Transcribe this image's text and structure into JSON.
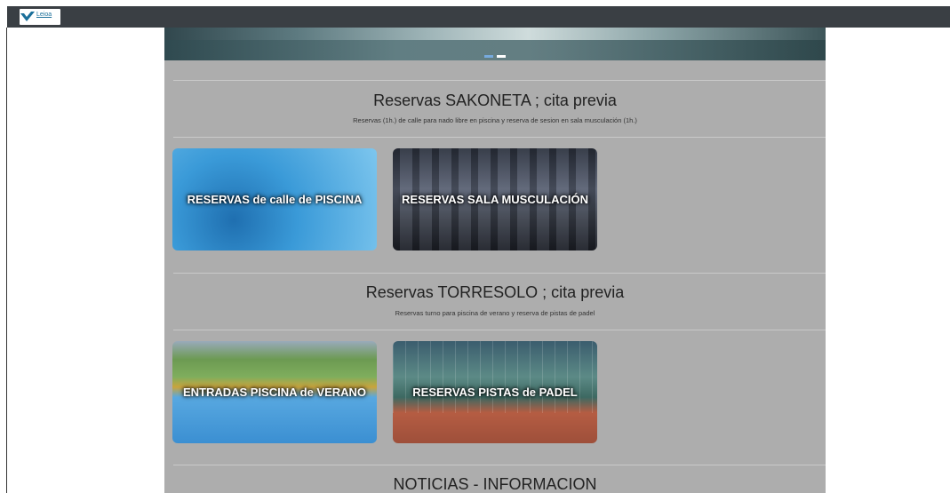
{
  "header": {
    "logo_text": "Leioa"
  },
  "hero": {
    "slides": 2,
    "active_slide": 2
  },
  "sections": [
    {
      "title": "Reservas SAKONETA ; cita previa",
      "subtitle": "Reservas (1h.) de calle para nado libre en piscina y reserva de sesion en sala musculación (1h.)",
      "cards": [
        {
          "label": "RESERVAS de calle de PISCINA"
        },
        {
          "label": "RESERVAS SALA MUSCULACIÓN"
        }
      ]
    },
    {
      "title": "Reservas TORRESOLO ; cita previa",
      "subtitle": "Reservas turno para piscina de verano y reserva de pistas de padel",
      "cards": [
        {
          "label": "ENTRADAS PISCINA de VERANO"
        },
        {
          "label": "RESERVAS PISTAS de PADEL"
        }
      ]
    },
    {
      "title": "NOTICIAS - INFORMACION"
    }
  ],
  "colors": {
    "topbar": "#3a3f44",
    "content_bg": "#adadad",
    "page_bg": "#ffffff"
  }
}
